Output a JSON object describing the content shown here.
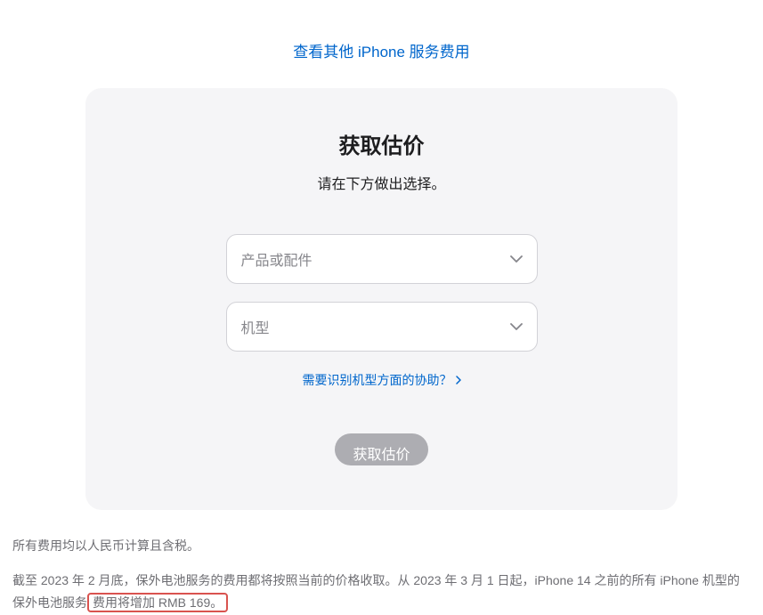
{
  "topLink": {
    "text": "查看其他 iPhone 服务费用"
  },
  "card": {
    "title": "获取估价",
    "subtitle": "请在下方做出选择。",
    "select1": {
      "placeholder": "产品或配件"
    },
    "select2": {
      "placeholder": "机型"
    },
    "helpLink": "需要识别机型方面的协助？",
    "submitLabel": "获取估价"
  },
  "footer": {
    "line1": "所有费用均以人民币计算且含税。",
    "line2_start": "截至 2023 年 2 月底，保外电池服务的费用都将按照当前的价格收取。从 2023 年 3 月 1 日起，iPhone 14 之前的所有 iPhone 机型的保外电池服务",
    "line2_highlight": "费用将增加 RMB 169。"
  }
}
